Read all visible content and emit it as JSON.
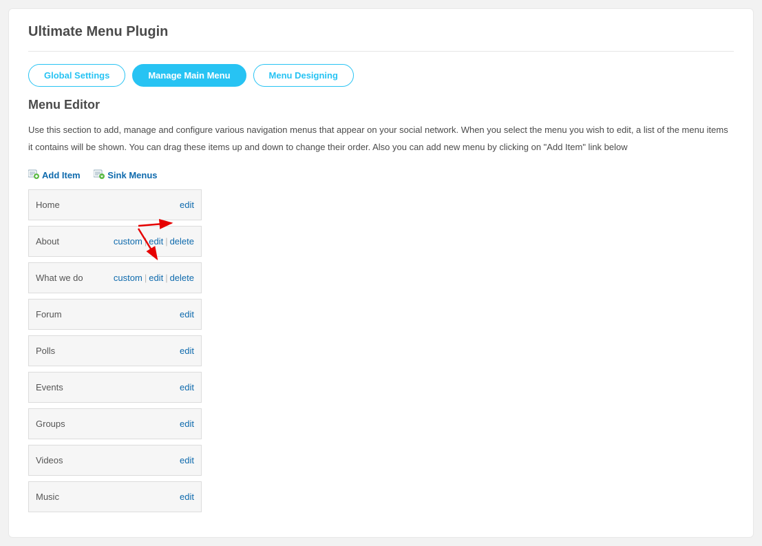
{
  "page_title": "Ultimate Menu Plugin",
  "tabs": [
    {
      "label": "Global Settings",
      "active": false
    },
    {
      "label": "Manage Main Menu",
      "active": true
    },
    {
      "label": "Menu Designing",
      "active": false
    }
  ],
  "section_title": "Menu Editor",
  "description": "Use this section to add, manage and configure various navigation menus that appear on your social network. When you select the menu you wish to edit, a list of the menu items it contains will be shown. You can drag these items up and down to change their order. Also you can add new menu by clicking on \"Add Item\" link below",
  "actions": {
    "add_item": "Add Item",
    "sink_menus": "Sink Menus"
  },
  "link_labels": {
    "custom": "custom",
    "edit": "edit",
    "delete": "delete"
  },
  "menu_items": [
    {
      "label": "Home",
      "show_custom": false,
      "show_delete": false
    },
    {
      "label": "About",
      "show_custom": true,
      "show_delete": true
    },
    {
      "label": "What we do",
      "show_custom": true,
      "show_delete": true
    },
    {
      "label": "Forum",
      "show_custom": false,
      "show_delete": false
    },
    {
      "label": "Polls",
      "show_custom": false,
      "show_delete": false
    },
    {
      "label": "Events",
      "show_custom": false,
      "show_delete": false
    },
    {
      "label": "Groups",
      "show_custom": false,
      "show_delete": false
    },
    {
      "label": "Videos",
      "show_custom": false,
      "show_delete": false
    },
    {
      "label": "Music",
      "show_custom": false,
      "show_delete": false
    }
  ]
}
